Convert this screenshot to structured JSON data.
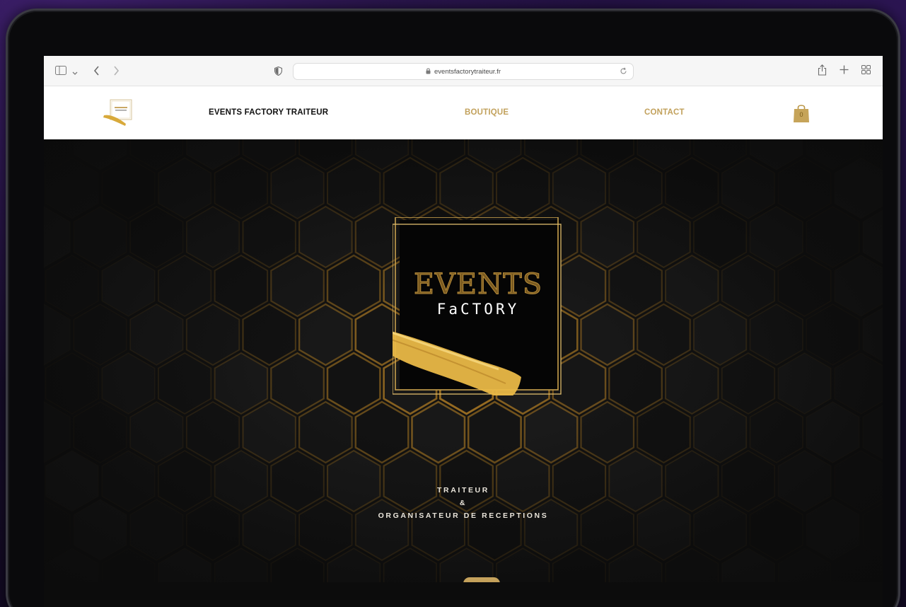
{
  "browser": {
    "url": "eventsfactorytraiteur.fr",
    "icons": {
      "sidebar": "sidebar-icon",
      "chevron": "chevron-down-icon",
      "back": "back-icon",
      "forward": "forward-icon",
      "shield": "shield-icon",
      "lock": "lock-icon",
      "reload": "reload-icon",
      "share": "share-icon",
      "new_tab": "plus-icon",
      "tabs": "tab-overview-icon"
    }
  },
  "header": {
    "brand": "EVENTS FACTORY TRAITEUR",
    "nav": {
      "boutique": "BOUTIQUE",
      "contact": "CONTACT"
    },
    "cart_count": "0",
    "accent_color": "#c2a15c"
  },
  "hero": {
    "logo_line1": "EVENTS",
    "logo_line2": "FaCTORY",
    "tagline_1": "TRAITEUR",
    "tagline_2": "&",
    "tagline_3": "ORGANISATEUR DE RECEPTIONS",
    "scroll_icon": "arrow-down-icon",
    "gold_color": "#c7a45e"
  }
}
